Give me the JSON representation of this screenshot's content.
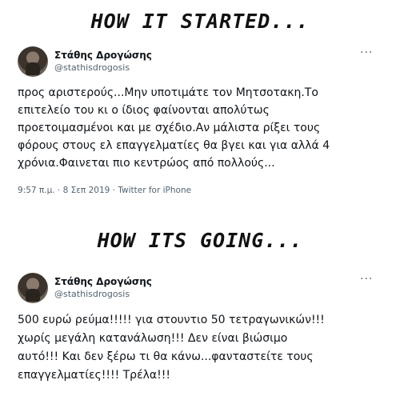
{
  "headings": {
    "started": "HOW IT STARTED...",
    "going": "HOW ITS GOING..."
  },
  "tweet1": {
    "name": "Στάθης Δρογώσης",
    "handle": "@stathisdrogosis",
    "more": "···",
    "lines": [
      "προς αριστερούς...Μην υποτιμάτε τον Μητσοτακη.Το",
      "επιτελείο του κι ο ίδιος φαίνονται απολύτως",
      "προετοιμασμένοι και με σχέδιο.Αν μάλιστα ρίξει τους",
      "φόρους στους ελ επαγγελματίες θα βγει και για αλλά 4",
      "χρόνια.Φαινεται πιο κεντρώος από πολλούς..."
    ],
    "meta": "9:57 π.μ. · 8 Σεπ 2019 · Twitter for iPhone"
  },
  "tweet2": {
    "name": "Στάθης Δρογώσης",
    "handle": "@stathisdrogosis",
    "more": "···",
    "lines": [
      "500 ευρώ ρεύμα!!!!! για στουντιο 50 τετραγωνικών!!!",
      "χωρίς μεγάλη κατανάλωση!!! Δεν είναι βιώσιμο",
      "αυτό!!! Και δεν ξέρω τι θα κάνω...φανταστείτε τους",
      "επαγγελματίες!!!! Τρέλα!!!"
    ]
  }
}
